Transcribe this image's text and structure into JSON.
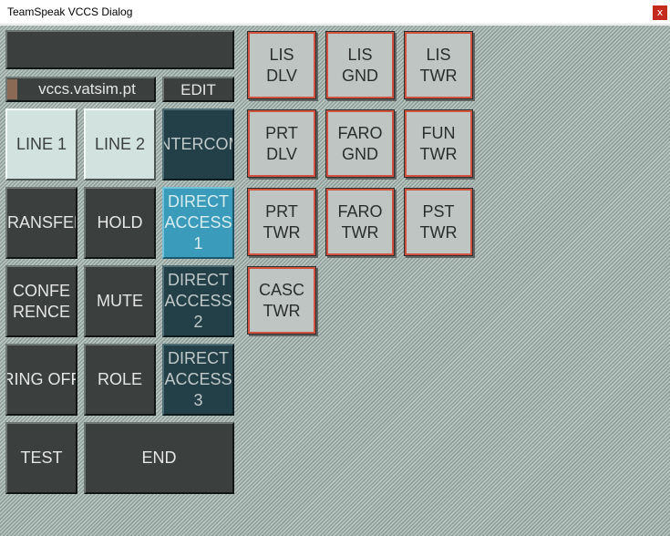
{
  "window": {
    "title": "TeamSpeak VCCS Dialog",
    "close": "x"
  },
  "server": {
    "name": "vccs.vatsim.pt",
    "edit": "EDIT"
  },
  "controls": {
    "line1": "LINE 1",
    "line2": "LINE 2",
    "intercom": "INTERCOM",
    "transfer": "TRANSFER",
    "hold": "HOLD",
    "direct1": "DIRECT\nACCESS\n1",
    "conference": "CONFE\nRENCE",
    "mute": "MUTE",
    "direct2": "DIRECT\nACCESS\n2",
    "ringoff": "RING OFF",
    "role": "ROLE",
    "direct3": "DIRECT\nACCESS\n3",
    "test": "TEST",
    "end": "END"
  },
  "stations": [
    "LIS\nDLV",
    "LIS\nGND",
    "LIS\nTWR",
    "PRT\nDLV",
    "FARO\nGND",
    "FUN\nTWR",
    "PRT\nTWR",
    "FARO\nTWR",
    "PST\nTWR",
    "CASC\nTWR"
  ],
  "colors": {
    "panel_dark": "#3b3f3e",
    "line_light": "#d2e3df",
    "teal_dark": "#233f47",
    "teal_active": "#3a9cba",
    "station_bg": "#bfc5c3",
    "station_border": "#d0523f"
  }
}
